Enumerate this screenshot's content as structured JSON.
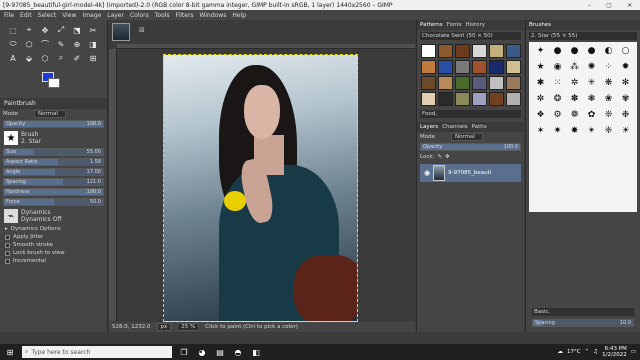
{
  "window": {
    "title": "[9-97085_beautiful-girl-model-4k] (imported)-2.0 (RGB color 8-bit gamma integer, GIMP built-in sRGB, 1 layer) 1440x2560 – GIMP",
    "controls": [
      "–",
      "▢",
      "✕"
    ]
  },
  "menu": [
    "File",
    "Edit",
    "Select",
    "View",
    "Image",
    "Layer",
    "Colors",
    "Tools",
    "Filters",
    "Windows",
    "Help"
  ],
  "toolbox": {
    "tool_icons": [
      "⬚",
      "⌖",
      "✥",
      "⤢",
      "⬔",
      "✂",
      "⬭",
      "⬠",
      "⌒",
      "✎",
      "⊕",
      "◨",
      "A",
      "⬙",
      "⬡",
      "⌕",
      "✐",
      "⊞"
    ],
    "fg_color": "#1a3adf",
    "bg_color": "#ffffff",
    "options_title": "Paintbrush",
    "mode_label": "Mode",
    "mode_value": "Normal",
    "opacity_label": "Opacity",
    "opacity_value": "100.0",
    "brush_label": "Brush",
    "brush_value": "2. Star",
    "size_label": "Size",
    "size_value": "55.00",
    "aspect_label": "Aspect Ratio",
    "aspect_value": "1.58",
    "angle_label": "Angle",
    "angle_value": "17.00",
    "spacing_label": "Spacing",
    "spacing_value": "121.0",
    "hardness_label": "Hardness",
    "hardness_value": "100.0",
    "force_label": "Force",
    "force_value": "50.0",
    "dynamics_label": "Dynamics",
    "dynamics_value": "Dynamics Off",
    "dynamics_options": "Dynamics Options",
    "apply_jitter": "Apply Jitter",
    "smooth_stroke": "Smooth stroke",
    "lock_brush": "Lock brush to view",
    "incremental": "Incremental"
  },
  "status": {
    "coords": "528.0, 1232.0",
    "unit": "px",
    "zoom": "25 %",
    "message": "Click to paint (Ctrl to pick a color)"
  },
  "patterns_panel": {
    "tabs": [
      "Patterns",
      "Fonts",
      "History"
    ],
    "current": "Chocolate Swirl (50 × 50)",
    "filter": "Food,",
    "colors": [
      "#ffffff",
      "#8a5a2c",
      "#6b3b1c",
      "#d8d8d8",
      "#c4b07a",
      "#3a5a8a",
      "#c07a3a",
      "#2a50a8",
      "#7a7a7a",
      "#a0522d",
      "#1a2a6a",
      "#d0c090",
      "#6a4a2a",
      "#b88a5a",
      "#4a6a2a",
      "#5a5a7a",
      "#c0c0c0",
      "#9a7a5a",
      "#e0d0b0",
      "#2a2a2a",
      "#8a8a5a",
      "#a0a0c0",
      "#704020",
      "#b0b0b0"
    ]
  },
  "layers_panel": {
    "tabs": [
      "Layers",
      "Channels",
      "Paths"
    ],
    "mode_label": "Mode",
    "mode_value": "Normal",
    "opacity_label": "Opacity",
    "opacity_value": "100.0",
    "lock_label": "Lock:",
    "layer_name": "9-97085_beauti"
  },
  "brushes_panel": {
    "tabs": [
      "Brushes"
    ],
    "current": "2. Star (55 × 55)",
    "glyphs": [
      "✦",
      "●",
      "●",
      "●",
      "◐",
      "○",
      "★",
      "◉",
      "⁂",
      "✺",
      "⁘",
      "✹",
      "✱",
      "⁙",
      "✲",
      "✳",
      "❋",
      "✻",
      "✼",
      "❂",
      "✽",
      "❃",
      "❀",
      "✾",
      "❖",
      "⚙",
      "❁",
      "✿",
      "❊",
      "❉",
      "✶",
      "✷",
      "✸",
      "✴",
      "❈",
      "☀"
    ],
    "filter": "Basic,",
    "spacing_label": "Spacing",
    "spacing_value": "10.0"
  },
  "taskbar": {
    "search_placeholder": "Type here to search",
    "weather": "17°C",
    "time": "6:43 PM",
    "date": "1/2/2022"
  }
}
